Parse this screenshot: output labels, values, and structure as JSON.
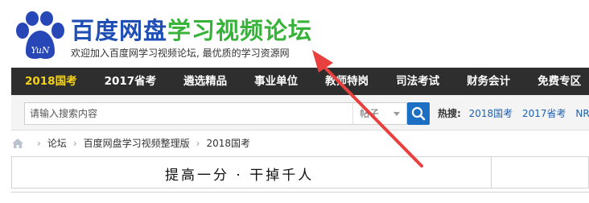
{
  "header": {
    "logo_text": "YuN",
    "title_part1": "百度网盘",
    "title_part2": "学习视频论坛",
    "slogan": "欢迎加入百度网学习视频论坛, 最优质的学习资源网",
    "colors": {
      "title_blue": "#1f4fb5",
      "title_green": "#37b33a"
    }
  },
  "nav": {
    "items": [
      {
        "label": "2018国考",
        "active": true
      },
      {
        "label": "2017省考"
      },
      {
        "label": "遴选精品"
      },
      {
        "label": "事业单位"
      },
      {
        "label": "教师特岗"
      },
      {
        "label": "司法考试"
      },
      {
        "label": "财务会计"
      },
      {
        "label": "免费专区"
      }
    ],
    "active_color": "#f5d21c"
  },
  "search": {
    "placeholder": "请输入搜索内容",
    "scope": "帖子",
    "button_icon": "search-icon",
    "hot_label": "热搜:",
    "hot_links": [
      "2018国考",
      "2017省考",
      "NRI考"
    ]
  },
  "breadcrumb": {
    "home_icon": "home-icon",
    "items": [
      "论坛",
      "百度网盘学习视频整理版",
      "2018国考"
    ]
  },
  "content": {
    "motto": "提高一分 · 干掉千人"
  },
  "annotation": {
    "arrow_color": "#e8403f"
  }
}
